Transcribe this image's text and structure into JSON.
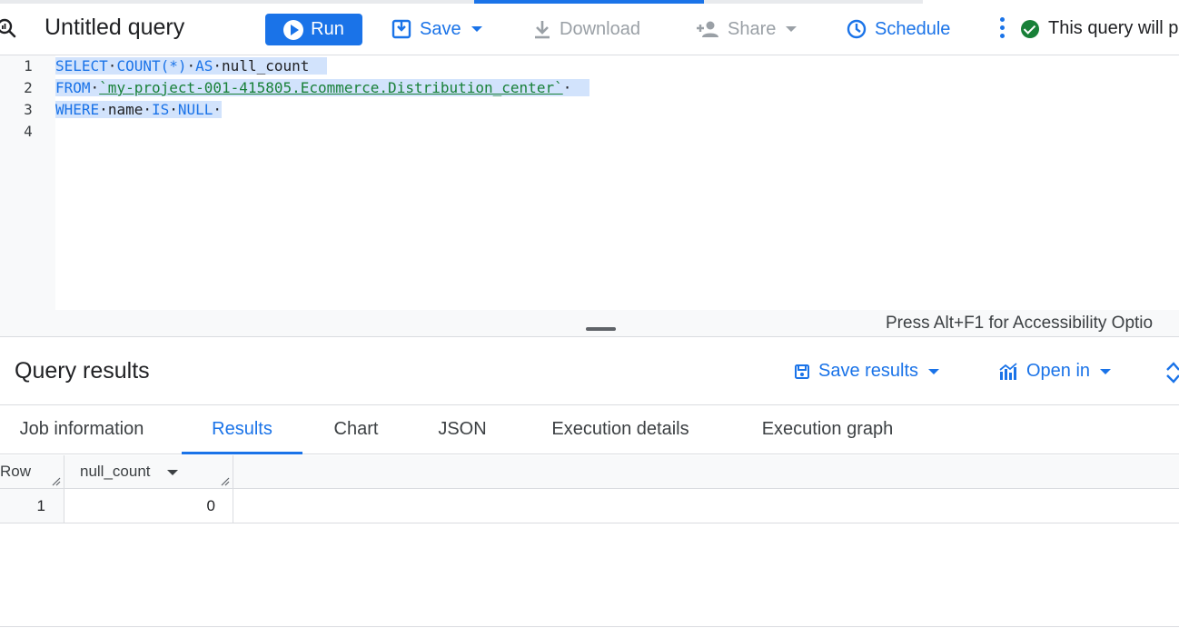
{
  "toolbar": {
    "title": "Untitled query",
    "run_label": "Run",
    "save_label": "Save",
    "download_label": "Download",
    "share_label": "Share",
    "schedule_label": "Schedule",
    "status_text": "This query will p"
  },
  "editor": {
    "lines": [
      {
        "number": "1",
        "tokens": [
          "SELECT",
          "COUNT(*)",
          "AS",
          "null_count"
        ]
      },
      {
        "number": "2",
        "tokens": [
          "FROM",
          "`my-project-001-415805.Ecommerce.Distribution_center`"
        ]
      },
      {
        "number": "3",
        "tokens": [
          "WHERE",
          "name",
          "IS",
          "NULL"
        ]
      },
      {
        "number": "4",
        "tokens": []
      }
    ],
    "accessibility_hint": "Press Alt+F1 for Accessibility Optio"
  },
  "results": {
    "title": "Query results",
    "save_results_label": "Save results",
    "open_in_label": "Open in",
    "tabs": [
      "Job information",
      "Results",
      "Chart",
      "JSON",
      "Execution details",
      "Execution graph"
    ],
    "active_tab": "Results",
    "columns": [
      "Row",
      "null_count"
    ],
    "rows": [
      {
        "row": "1",
        "null_count": "0"
      }
    ]
  },
  "colors": {
    "accent": "#1a73e8",
    "success": "#188038",
    "selection": "#d2e3fc"
  }
}
